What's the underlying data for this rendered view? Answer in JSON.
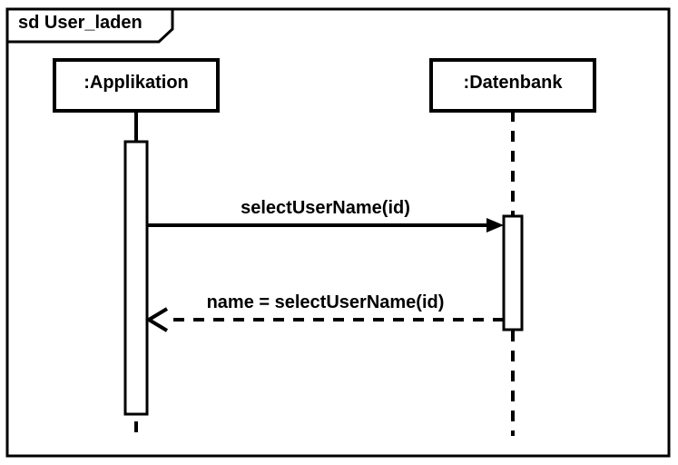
{
  "diagram": {
    "type": "uml-sequence",
    "title": "sd User_laden",
    "participants": [
      {
        "name": ":Applikation"
      },
      {
        "name": ":Datenbank"
      }
    ],
    "messages": [
      {
        "label": "selectUserName(id)",
        "from": 0,
        "to": 1,
        "kind": "call"
      },
      {
        "label": "name = selectUserName(id)",
        "from": 1,
        "to": 0,
        "kind": "return"
      }
    ]
  }
}
